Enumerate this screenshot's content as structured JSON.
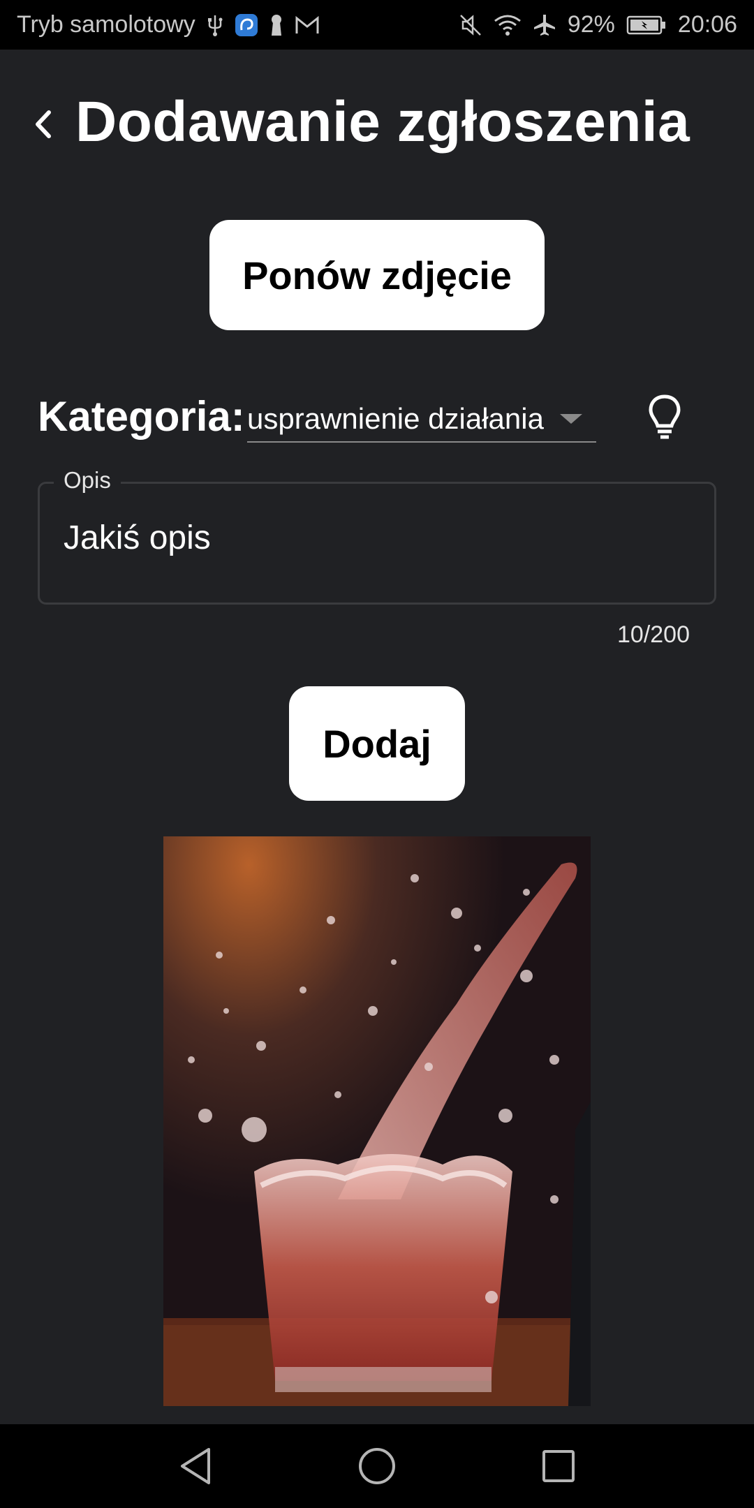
{
  "status_bar": {
    "mode_text": "Tryb samolotowy",
    "battery": "92%",
    "time": "20:06",
    "icons_left": [
      "usb-icon",
      "app-notification-icon",
      "keyhole-icon",
      "gmail-icon"
    ],
    "icons_right": [
      "muted-icon",
      "wifi-icon",
      "airplane-icon",
      "battery-icon"
    ]
  },
  "header": {
    "title": "Dodawanie zgłoszenia"
  },
  "actions": {
    "retake_label": "Ponów zdjęcie",
    "add_label": "Dodaj"
  },
  "form": {
    "category_label": "Kategoria:",
    "category_value": "usprawnienie działania",
    "description_label": "Opis",
    "description_value": "Jakiś opis",
    "char_counter": "10/200"
  },
  "colors": {
    "background": "#202124",
    "button_bg": "#ffffff",
    "button_text": "#000000",
    "bar_bg": "#000000"
  }
}
